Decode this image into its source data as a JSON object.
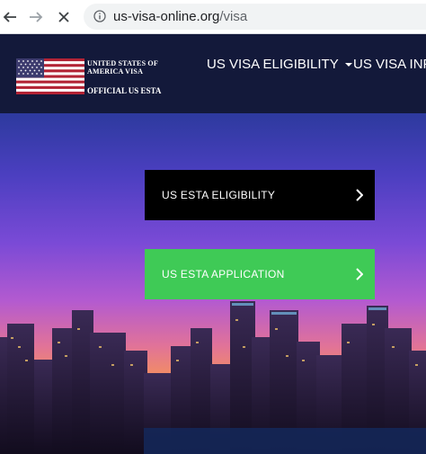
{
  "browser": {
    "url_domain": "us-visa-online.org",
    "url_path": "/visa"
  },
  "site": {
    "brand_line1": "UNITED STATES OF",
    "brand_line2": "AMERICA VISA",
    "brand_sub": "OFFICIAL US ESTA",
    "nav": [
      {
        "label": "US VISA ELIGIBILITY"
      },
      {
        "label": "US VISA INFO"
      }
    ]
  },
  "hero": {
    "cta_eligibility": "US ESTA ELIGIBILITY",
    "cta_application": "US ESTA APPLICATION"
  },
  "colors": {
    "header_bg": "#13193a",
    "cta_primary": "#000000",
    "cta_secondary": "#3fca56"
  }
}
